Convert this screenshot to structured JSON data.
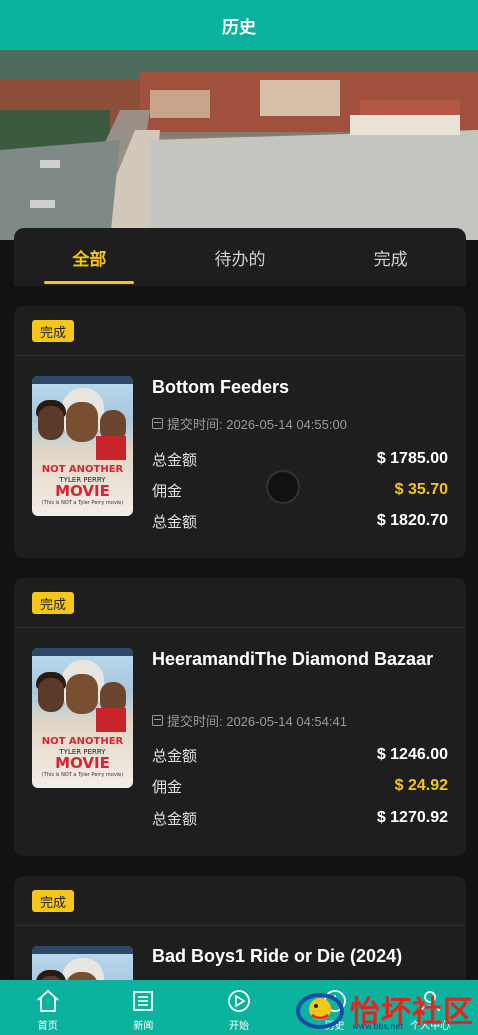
{
  "header": {
    "title": "历史"
  },
  "tabs": [
    {
      "label": "全部",
      "active": true
    },
    {
      "label": "待办的",
      "active": false
    },
    {
      "label": "完成",
      "active": false
    }
  ],
  "orders": [
    {
      "status": "完成",
      "title": "Bottom Feeders",
      "time": "提交时间: 2026-05-14 04:55:00",
      "rows": [
        {
          "label": "总金额",
          "value": "$ 1785.00"
        },
        {
          "label": "佣金",
          "value": "$ 35.70"
        },
        {
          "label": "总金额",
          "value": "$ 1820.70"
        }
      ]
    },
    {
      "status": "完成",
      "title": "HeeramandiThe Diamond Bazaar",
      "time": "提交时间: 2026-05-14 04:54:41",
      "rows": [
        {
          "label": "总金额",
          "value": "$ 1246.00"
        },
        {
          "label": "佣金",
          "value": "$ 24.92"
        },
        {
          "label": "总金额",
          "value": "$ 1270.92"
        }
      ]
    },
    {
      "status": "完成",
      "title": "Bad Boys1 Ride or Die (2024)"
    }
  ],
  "poster": {
    "line1": "NOT ANOTHER",
    "line2": "TYLER PERRY",
    "line3": "MOVIE",
    "line4": "(This is NOT a Tyler Perry movie)"
  },
  "nav": [
    {
      "label": "首页",
      "icon": "home-icon"
    },
    {
      "label": "新闻",
      "icon": "news-icon"
    },
    {
      "label": "开始",
      "icon": "play-icon"
    },
    {
      "label": "历史",
      "icon": "history-icon"
    },
    {
      "label": "个人中心",
      "icon": "user-icon"
    }
  ],
  "watermark": {
    "text": "怡坏社区",
    "sub": "www.bbs.net"
  },
  "colors": {
    "accent": "#0bb39f",
    "gold": "#f5c518",
    "card": "#1e1e1e",
    "background": "#121212"
  }
}
